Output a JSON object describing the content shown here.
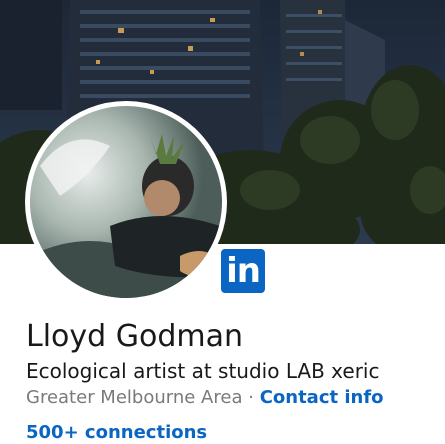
{
  "profile": {
    "name": "Lloyd Godman",
    "headline": "Ecological artist at studio LAB xeric",
    "location": "Greater Melbourne Area",
    "separator": "·",
    "contact_info": "Contact info",
    "connections": "500+ connections"
  },
  "badge": {
    "text": "in"
  },
  "colors": {
    "brand": "#0a66c2",
    "name_text": "#191919",
    "muted_text": "#7a7a7a"
  }
}
